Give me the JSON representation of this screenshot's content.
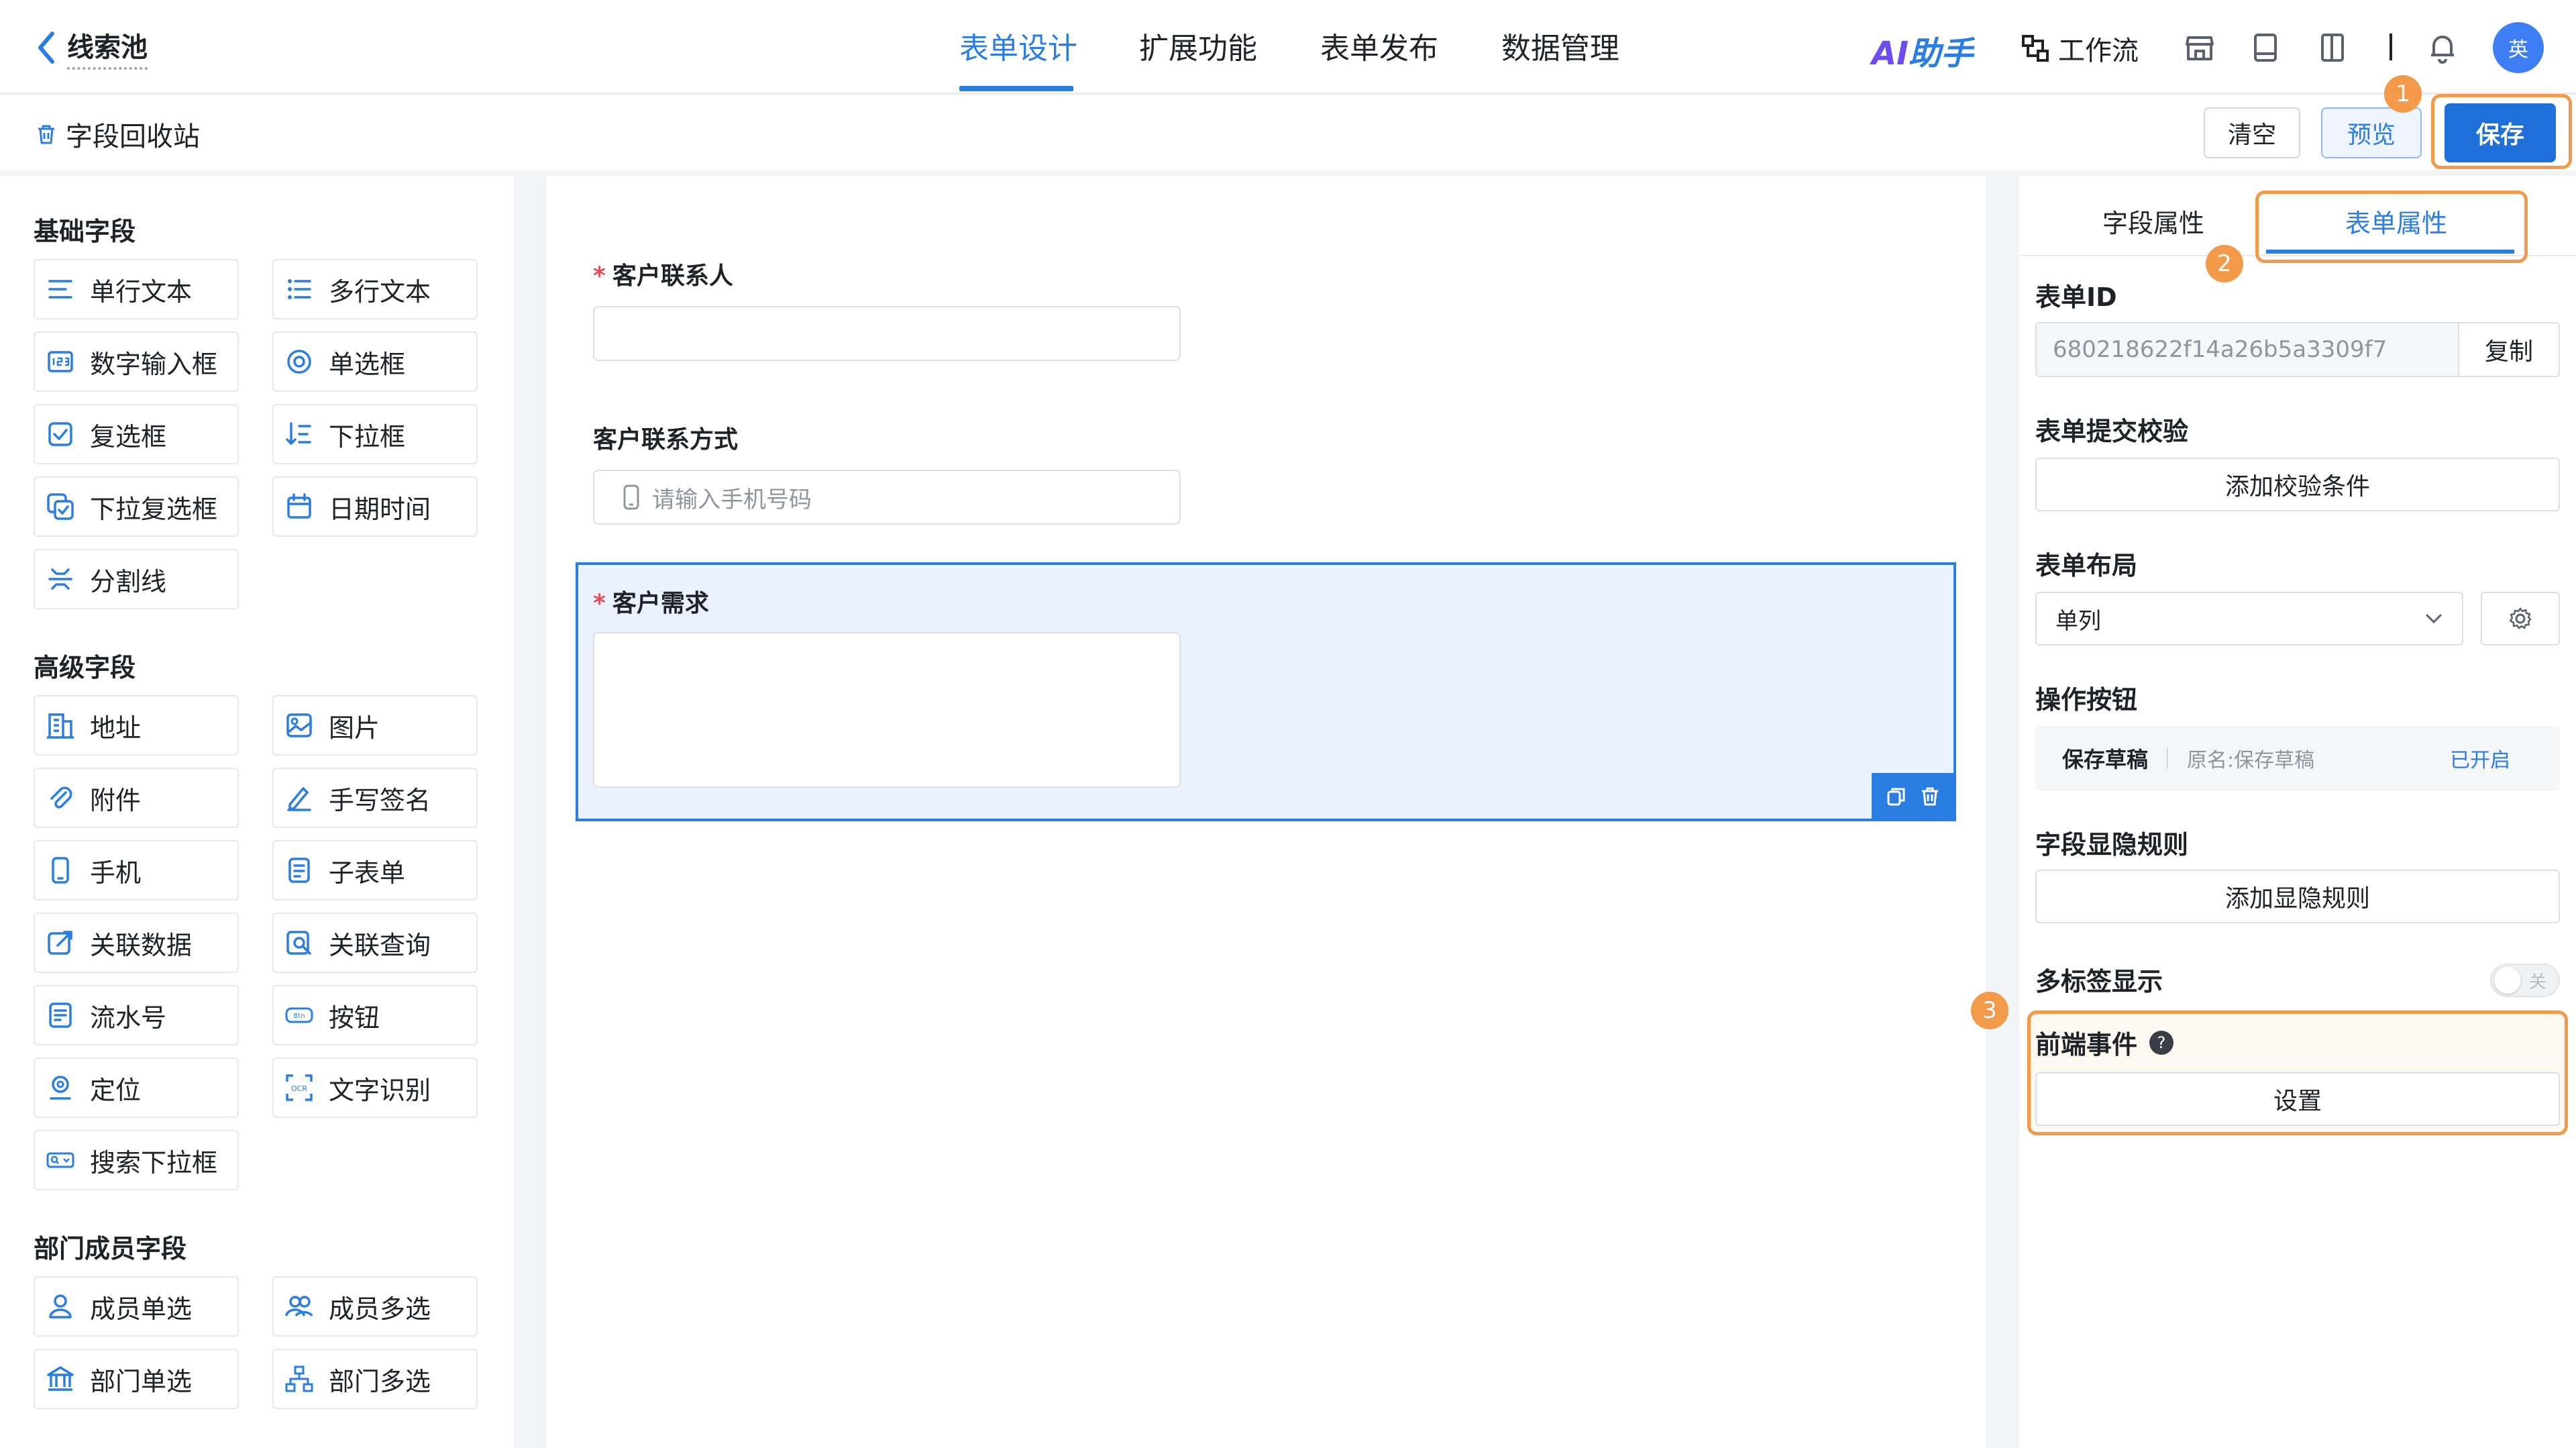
{
  "header": {
    "back_title": "线索池",
    "tabs": [
      {
        "label": "表单设计",
        "active": true
      },
      {
        "label": "扩展功能",
        "active": false
      },
      {
        "label": "表单发布",
        "active": false
      },
      {
        "label": "数据管理",
        "active": false
      }
    ],
    "ai_assistant": {
      "prefix": "AI",
      "suffix": "助手"
    },
    "workflow_label": "工作流",
    "avatar_text": "英"
  },
  "subbar": {
    "recycle_label": "字段回收站",
    "clear_label": "清空",
    "preview_label": "预览",
    "save_label": "保存"
  },
  "annotations": [
    "1",
    "2",
    "3"
  ],
  "left_panel": {
    "sections": [
      {
        "title": "基础字段",
        "items": [
          {
            "label": "单行文本",
            "icon": "single-line-text-icon"
          },
          {
            "label": "多行文本",
            "icon": "multi-line-text-icon"
          },
          {
            "label": "数字输入框",
            "icon": "number-input-icon"
          },
          {
            "label": "单选框",
            "icon": "radio-icon"
          },
          {
            "label": "复选框",
            "icon": "checkbox-icon"
          },
          {
            "label": "下拉框",
            "icon": "dropdown-icon"
          },
          {
            "label": "下拉复选框",
            "icon": "dropdown-checkbox-icon"
          },
          {
            "label": "日期时间",
            "icon": "calendar-icon"
          },
          {
            "label": "分割线",
            "icon": "divider-icon"
          }
        ]
      },
      {
        "title": "高级字段",
        "items": [
          {
            "label": "地址",
            "icon": "address-icon"
          },
          {
            "label": "图片",
            "icon": "image-icon"
          },
          {
            "label": "附件",
            "icon": "attachment-icon"
          },
          {
            "label": "手写签名",
            "icon": "signature-icon"
          },
          {
            "label": "手机",
            "icon": "phone-icon"
          },
          {
            "label": "子表单",
            "icon": "subform-icon"
          },
          {
            "label": "关联数据",
            "icon": "linked-data-icon"
          },
          {
            "label": "关联查询",
            "icon": "linked-query-icon"
          },
          {
            "label": "流水号",
            "icon": "serial-number-icon"
          },
          {
            "label": "按钮",
            "icon": "button-icon"
          },
          {
            "label": "定位",
            "icon": "location-icon"
          },
          {
            "label": "文字识别",
            "icon": "ocr-icon"
          },
          {
            "label": "搜索下拉框",
            "icon": "search-dropdown-icon"
          }
        ]
      },
      {
        "title": "部门成员字段",
        "items": [
          {
            "label": "成员单选",
            "icon": "member-single-icon"
          },
          {
            "label": "成员多选",
            "icon": "member-multi-icon"
          },
          {
            "label": "部门单选",
            "icon": "department-single-icon"
          },
          {
            "label": "部门多选",
            "icon": "department-multi-icon"
          }
        ]
      }
    ]
  },
  "canvas": {
    "fields": [
      {
        "label": "客户联系人",
        "required": true,
        "placeholder": ""
      },
      {
        "label": "客户联系方式",
        "required": false,
        "placeholder": "请输入手机号码"
      },
      {
        "label": "客户需求",
        "required": true,
        "placeholder": ""
      }
    ],
    "required_mark": "*"
  },
  "right_panel": {
    "tabs": [
      {
        "label": "字段属性",
        "active": false
      },
      {
        "label": "表单属性",
        "active": true
      }
    ],
    "form_id_label": "表单ID",
    "form_id_value": "680218622f14a26b5a3309f7",
    "copy_label": "复制",
    "submit_validation_label": "表单提交校验",
    "add_validation_label": "添加校验条件",
    "layout_label": "表单布局",
    "layout_value": "单列",
    "action_buttons_label": "操作按钮",
    "action_button": {
      "name": "保存草稿",
      "original": "原名:保存草稿",
      "status": "已开启"
    },
    "visibility_rules_label": "字段显隐规则",
    "add_visibility_rule_label": "添加显隐规则",
    "multi_tab_label": "多标签显示",
    "multi_tab_toggle": "关",
    "frontend_events_label": "前端事件",
    "help_glyph": "?",
    "settings_label": "设置"
  },
  "colors": {
    "accent": "#2a7de1",
    "save_button": "#1f6fd8",
    "highlight": "#f2994a",
    "required": "#e34d59",
    "selected_bg": "#eaf2fe"
  }
}
